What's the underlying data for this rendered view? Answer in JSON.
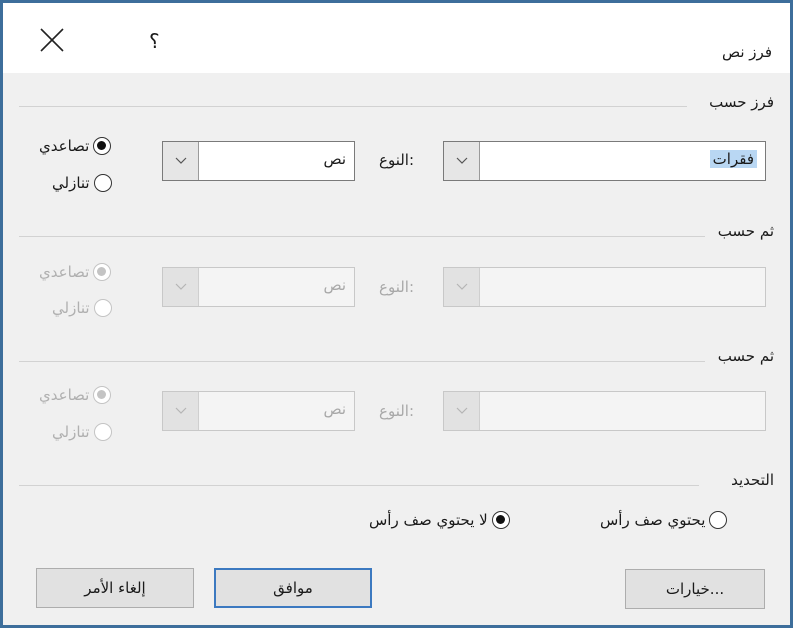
{
  "dialog": {
    "title": "فرز نص",
    "help_glyph": "؟"
  },
  "sort_by": {
    "label": "فرز حسب",
    "field_value": "فقرات",
    "type_label": "النوع:",
    "type_value": "نص",
    "ascending_label": "تصاعدي",
    "descending_label": "تنازلي",
    "selected": "ascending"
  },
  "then_by_1": {
    "label": "ثم حسب",
    "field_value": "",
    "type_label": "النوع:",
    "type_value": "نص",
    "ascending_label": "تصاعدي",
    "descending_label": "تنازلي",
    "selected": "ascending",
    "enabled": false
  },
  "then_by_2": {
    "label": "ثم حسب",
    "field_value": "",
    "type_label": "النوع:",
    "type_value": "نص",
    "ascending_label": "تصاعدي",
    "descending_label": "تنازلي",
    "selected": "ascending",
    "enabled": false
  },
  "selection": {
    "label": "التحديد",
    "has_header_label": "يحتوي صف رأس",
    "no_header_label": "لا يحتوي صف رأس",
    "selected": "no_header"
  },
  "buttons": {
    "options": "خيارات...",
    "ok": "موافق",
    "cancel": "إلغاء الأمر"
  },
  "icons": {
    "close": "close-icon",
    "help": "help-icon",
    "dropdown": "chevron-down-icon"
  }
}
